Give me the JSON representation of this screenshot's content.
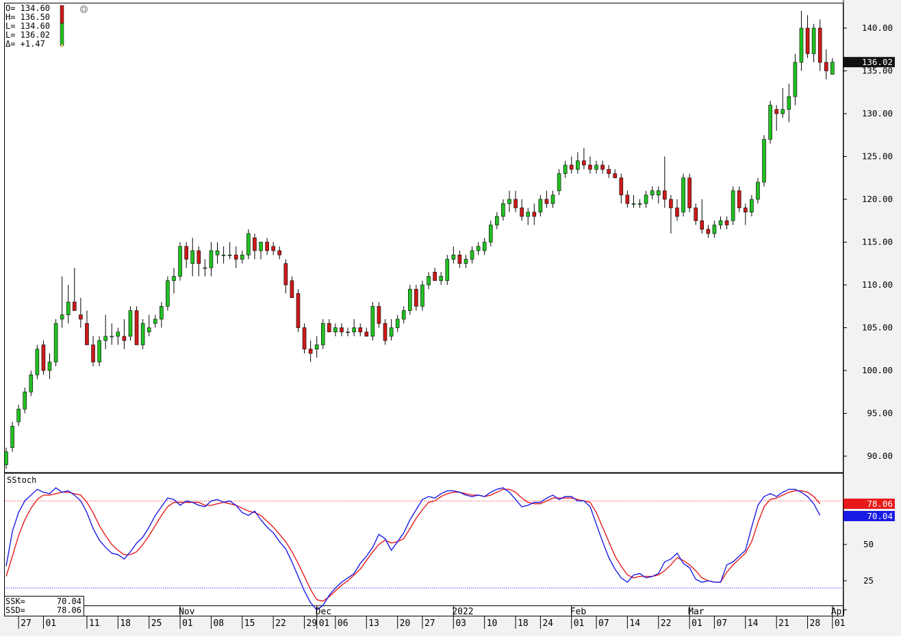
{
  "ohlc_readout": {
    "lines": [
      "O= 134.60",
      "H= 136.50",
      "L= 134.60",
      "L= 136.02",
      "Δ=  +1.47"
    ]
  },
  "stoch_readout": {
    "ssk_label": "SSK=",
    "ssk_value": "70.04",
    "ssd_label": "SSD=",
    "ssd_value": "78.06"
  },
  "price_badge": "136.02",
  "ssd_badge": "78.06",
  "ssk_badge": "70.04",
  "colors": {
    "up_candle": "#22c022",
    "down_candle": "#cc1a1a",
    "ssk_line": "#1a1ae6",
    "ssd_line": "#e61a1a",
    "price_badge_bg": "#111111"
  },
  "chart_data": [
    {
      "type": "candlestick",
      "ylim": [
        88,
        142
      ],
      "y_ticks": [
        "90.00",
        "95.00",
        "100.00",
        "105.00",
        "110.00",
        "115.00",
        "120.00",
        "125.00",
        "130.00",
        "135.00",
        "140.00"
      ],
      "y_tick_values": [
        90,
        95,
        100,
        105,
        110,
        115,
        120,
        125,
        130,
        135,
        140
      ],
      "x_day_labels": [
        "27",
        "01",
        "11",
        "18",
        "25",
        "01",
        "08",
        "15",
        "22",
        "29",
        "01",
        "06",
        "13",
        "20",
        "27",
        "03",
        "10",
        "18",
        "24",
        "01",
        "07",
        "14",
        "22",
        "01",
        "07",
        "14",
        "21",
        "28",
        "01"
      ],
      "x_day_label_index": [
        2,
        6,
        13,
        18,
        23,
        28,
        33,
        38,
        43,
        48,
        50,
        53,
        58,
        63,
        67,
        72,
        77,
        82,
        86,
        91,
        95,
        100,
        105,
        110,
        114,
        119,
        124,
        129,
        133
      ],
      "x_month_labels": [
        "Nov",
        "Dec",
        "2022",
        "Feb",
        "Mar",
        "Apr"
      ],
      "x_month_label_index": [
        28,
        50,
        72,
        91,
        110,
        133
      ],
      "ohlc": [
        [
          89.0,
          91.0,
          88.5,
          90.5
        ],
        [
          91.0,
          94.0,
          90.5,
          93.5
        ],
        [
          94.0,
          96.0,
          93.5,
          95.5
        ],
        [
          95.5,
          98.0,
          95.0,
          97.5
        ],
        [
          97.5,
          100.0,
          97.0,
          99.5
        ],
        [
          99.5,
          103.0,
          99.0,
          102.5
        ],
        [
          103.0,
          103.5,
          99.5,
          100.0
        ],
        [
          100.0,
          102.0,
          99.0,
          101.0
        ],
        [
          101.0,
          106.0,
          100.5,
          105.5
        ],
        [
          106.0,
          111.0,
          105.0,
          106.5
        ],
        [
          106.5,
          110.0,
          105.5,
          108.0
        ],
        [
          108.0,
          112.0,
          107.0,
          107.0
        ],
        [
          106.5,
          108.5,
          105.0,
          106.0
        ],
        [
          105.5,
          107.0,
          103.0,
          103.0
        ],
        [
          103.0,
          104.0,
          100.5,
          101.0
        ],
        [
          101.0,
          104.0,
          100.5,
          103.5
        ],
        [
          103.5,
          106.5,
          102.5,
          104.0
        ],
        [
          104.0,
          105.5,
          103.0,
          104.0
        ],
        [
          104.0,
          105.0,
          103.0,
          104.5
        ],
        [
          104.0,
          106.0,
          102.5,
          103.5
        ],
        [
          104.0,
          107.5,
          103.5,
          107.0
        ],
        [
          107.0,
          107.5,
          103.0,
          103.0
        ],
        [
          103.0,
          106.0,
          102.5,
          105.5
        ],
        [
          104.5,
          106.5,
          104.0,
          105.0
        ],
        [
          105.5,
          106.5,
          105.0,
          106.0
        ],
        [
          106.0,
          108.0,
          105.0,
          107.5
        ],
        [
          107.5,
          111.0,
          107.0,
          110.5
        ],
        [
          110.5,
          112.0,
          109.0,
          111.0
        ],
        [
          111.0,
          115.0,
          110.5,
          114.5
        ],
        [
          114.5,
          115.0,
          112.0,
          113.0
        ],
        [
          112.5,
          115.5,
          111.0,
          114.0
        ],
        [
          114.0,
          114.5,
          111.0,
          112.5
        ],
        [
          112.0,
          113.0,
          111.0,
          112.0
        ],
        [
          112.0,
          115.0,
          111.0,
          114.0
        ],
        [
          113.5,
          115.0,
          112.5,
          114.0
        ],
        [
          113.5,
          114.5,
          112.5,
          113.5
        ],
        [
          113.5,
          115.0,
          113.0,
          113.5
        ],
        [
          113.5,
          114.5,
          112.0,
          113.0
        ],
        [
          113.0,
          114.0,
          112.5,
          113.5
        ],
        [
          113.5,
          116.5,
          113.0,
          116.0
        ],
        [
          115.5,
          116.0,
          113.0,
          114.0
        ],
        [
          114.0,
          115.0,
          113.0,
          115.0
        ],
        [
          115.0,
          115.5,
          113.5,
          114.0
        ],
        [
          114.5,
          115.0,
          113.5,
          114.0
        ],
        [
          114.0,
          114.5,
          113.0,
          113.5
        ],
        [
          112.5,
          113.0,
          109.0,
          110.0
        ],
        [
          110.5,
          111.0,
          108.5,
          108.5
        ],
        [
          109.0,
          109.5,
          104.5,
          105.0
        ],
        [
          105.0,
          105.5,
          102.0,
          102.5
        ],
        [
          102.5,
          103.5,
          101.0,
          102.0
        ],
        [
          102.5,
          104.0,
          101.5,
          103.0
        ],
        [
          103.0,
          106.0,
          102.5,
          105.5
        ],
        [
          105.5,
          106.0,
          104.5,
          104.5
        ],
        [
          104.5,
          105.5,
          104.0,
          105.0
        ],
        [
          105.0,
          105.5,
          104.0,
          104.5
        ],
        [
          104.5,
          105.0,
          104.0,
          104.5
        ],
        [
          104.5,
          106.0,
          104.0,
          105.0
        ],
        [
          105.0,
          105.5,
          104.0,
          104.5
        ],
        [
          104.5,
          105.0,
          104.0,
          104.0
        ],
        [
          104.0,
          108.0,
          103.5,
          107.5
        ],
        [
          107.5,
          108.0,
          105.0,
          105.5
        ],
        [
          105.5,
          106.0,
          103.0,
          103.5
        ],
        [
          104.0,
          106.0,
          103.5,
          105.0
        ],
        [
          105.0,
          106.5,
          104.5,
          106.0
        ],
        [
          106.0,
          107.5,
          105.5,
          107.0
        ],
        [
          107.0,
          110.0,
          106.5,
          109.5
        ],
        [
          109.5,
          110.0,
          107.0,
          107.5
        ],
        [
          107.5,
          110.5,
          107.0,
          110.0
        ],
        [
          110.0,
          111.5,
          109.5,
          111.0
        ],
        [
          111.5,
          112.0,
          110.5,
          110.5
        ],
        [
          110.5,
          111.5,
          110.0,
          111.0
        ],
        [
          110.5,
          113.5,
          110.0,
          113.0
        ],
        [
          113.0,
          114.5,
          112.5,
          113.5
        ],
        [
          113.5,
          114.0,
          112.0,
          112.5
        ],
        [
          112.5,
          113.5,
          112.0,
          113.0
        ],
        [
          113.0,
          114.5,
          112.5,
          114.0
        ],
        [
          114.0,
          115.0,
          113.5,
          114.5
        ],
        [
          114.0,
          115.5,
          113.5,
          115.0
        ],
        [
          115.0,
          117.5,
          114.5,
          117.0
        ],
        [
          117.0,
          118.5,
          116.5,
          118.0
        ],
        [
          118.0,
          120.0,
          117.5,
          119.5
        ],
        [
          119.5,
          121.0,
          118.5,
          120.0
        ],
        [
          120.0,
          121.0,
          118.5,
          119.0
        ],
        [
          119.0,
          120.0,
          117.5,
          118.0
        ],
        [
          118.0,
          119.0,
          117.0,
          118.5
        ],
        [
          118.5,
          119.5,
          117.0,
          118.0
        ],
        [
          118.5,
          120.5,
          118.0,
          120.0
        ],
        [
          120.0,
          121.0,
          119.0,
          119.5
        ],
        [
          119.5,
          121.0,
          119.0,
          120.5
        ],
        [
          121.0,
          123.5,
          120.5,
          123.0
        ],
        [
          123.0,
          124.5,
          122.5,
          124.0
        ],
        [
          124.0,
          125.0,
          123.0,
          123.5
        ],
        [
          123.5,
          125.5,
          123.0,
          124.5
        ],
        [
          124.5,
          126.0,
          123.5,
          124.0
        ],
        [
          124.0,
          125.0,
          123.0,
          123.5
        ],
        [
          123.5,
          124.5,
          123.0,
          124.0
        ],
        [
          124.0,
          124.5,
          123.0,
          123.5
        ],
        [
          123.5,
          124.0,
          122.5,
          123.0
        ],
        [
          123.0,
          123.5,
          122.5,
          122.5
        ],
        [
          122.5,
          123.0,
          119.5,
          120.5
        ],
        [
          120.5,
          121.0,
          119.0,
          119.5
        ],
        [
          119.5,
          120.5,
          119.0,
          119.5
        ],
        [
          119.5,
          120.0,
          119.0,
          119.5
        ],
        [
          119.5,
          121.0,
          119.0,
          120.5
        ],
        [
          120.5,
          121.5,
          120.0,
          121.0
        ],
        [
          120.5,
          121.5,
          119.5,
          121.0
        ],
        [
          121.0,
          125.0,
          119.0,
          120.0
        ],
        [
          120.0,
          120.5,
          116.0,
          119.0
        ],
        [
          119.0,
          120.0,
          117.5,
          118.0
        ],
        [
          118.5,
          123.0,
          118.0,
          122.5
        ],
        [
          122.5,
          123.0,
          118.5,
          119.0
        ],
        [
          119.0,
          119.5,
          117.0,
          117.5
        ],
        [
          117.5,
          120.0,
          116.0,
          116.5
        ],
        [
          116.5,
          117.0,
          115.5,
          116.0
        ],
        [
          116.0,
          117.5,
          115.5,
          117.0
        ],
        [
          117.0,
          118.0,
          116.5,
          117.5
        ],
        [
          117.5,
          118.0,
          116.5,
          117.0
        ],
        [
          117.5,
          121.5,
          117.0,
          121.0
        ],
        [
          121.0,
          121.5,
          118.5,
          119.0
        ],
        [
          119.0,
          119.5,
          117.0,
          118.5
        ],
        [
          118.5,
          120.5,
          118.0,
          120.0
        ],
        [
          120.0,
          122.5,
          119.5,
          122.0
        ],
        [
          122.0,
          127.5,
          121.5,
          127.0
        ],
        [
          127.0,
          131.5,
          126.5,
          131.0
        ],
        [
          130.5,
          131.0,
          128.0,
          130.0
        ],
        [
          130.0,
          133.0,
          129.5,
          130.5
        ],
        [
          130.5,
          133.5,
          129.0,
          132.0
        ],
        [
          132.0,
          137.0,
          131.0,
          136.0
        ],
        [
          136.0,
          142.0,
          135.0,
          140.0
        ],
        [
          140.0,
          141.5,
          136.5,
          137.0
        ],
        [
          137.0,
          140.5,
          136.0,
          140.0
        ],
        [
          140.0,
          141.0,
          135.0,
          136.0
        ],
        [
          136.0,
          137.5,
          134.0,
          135.0
        ],
        [
          134.6,
          136.5,
          134.6,
          136.02
        ]
      ]
    },
    {
      "type": "line",
      "title": "SStoch",
      "ylim": [
        0,
        100
      ],
      "y_ticks": [
        "25",
        "50"
      ],
      "y_tick_values": [
        25,
        50
      ],
      "reference_lines": [
        80,
        20
      ],
      "series": [
        {
          "name": "SSK",
          "values": [
            35,
            59,
            72,
            80,
            84,
            88,
            86,
            85,
            89,
            86,
            87,
            84,
            80,
            72,
            61,
            53,
            48,
            44,
            43,
            40,
            45,
            51,
            55,
            62,
            70,
            76,
            82,
            81,
            77,
            80,
            79,
            77,
            76,
            80,
            81,
            79,
            80,
            77,
            72,
            70,
            73,
            67,
            62,
            58,
            52,
            47,
            38,
            28,
            18,
            10,
            5,
            8,
            15,
            20,
            24,
            27,
            30,
            37,
            42,
            48,
            57,
            54,
            46,
            52,
            58,
            67,
            74,
            81,
            83,
            82,
            85,
            87,
            87,
            86,
            84,
            83,
            84,
            83,
            86,
            88,
            89,
            86,
            81,
            76,
            77,
            79,
            79,
            82,
            84,
            81,
            83,
            83,
            80,
            80,
            76,
            64,
            52,
            41,
            33,
            27,
            24,
            29,
            30,
            27,
            28,
            30,
            38,
            40,
            44,
            37,
            34,
            26,
            24,
            25,
            24,
            24,
            36,
            38,
            42,
            46,
            62,
            77,
            83,
            85,
            83,
            86,
            88,
            88,
            86,
            83,
            78,
            70.04
          ]
        },
        {
          "name": "SSD",
          "values": [
            28,
            42,
            56,
            67,
            75,
            81,
            84,
            84,
            85,
            86,
            86,
            85,
            84,
            79,
            72,
            63,
            56,
            50,
            46,
            43,
            43,
            45,
            50,
            56,
            63,
            70,
            76,
            79,
            79,
            79,
            79,
            79,
            77,
            77,
            78,
            79,
            78,
            77,
            75,
            73,
            72,
            70,
            66,
            62,
            57,
            52,
            45,
            37,
            28,
            19,
            12,
            11,
            14,
            18,
            22,
            25,
            29,
            33,
            39,
            45,
            50,
            53,
            51,
            52,
            54,
            61,
            68,
            74,
            79,
            80,
            83,
            85,
            86,
            86,
            85,
            84,
            84,
            83,
            84,
            86,
            88,
            88,
            86,
            82,
            79,
            78,
            78,
            80,
            82,
            82,
            82,
            82,
            81,
            80,
            79,
            72,
            62,
            52,
            42,
            35,
            29,
            27,
            28,
            28,
            28,
            29,
            32,
            36,
            41,
            39,
            36,
            32,
            27,
            25,
            24,
            24,
            31,
            36,
            40,
            44,
            52,
            65,
            76,
            81,
            82,
            84,
            86,
            87,
            87,
            86,
            83,
            78.06
          ]
        }
      ]
    }
  ]
}
